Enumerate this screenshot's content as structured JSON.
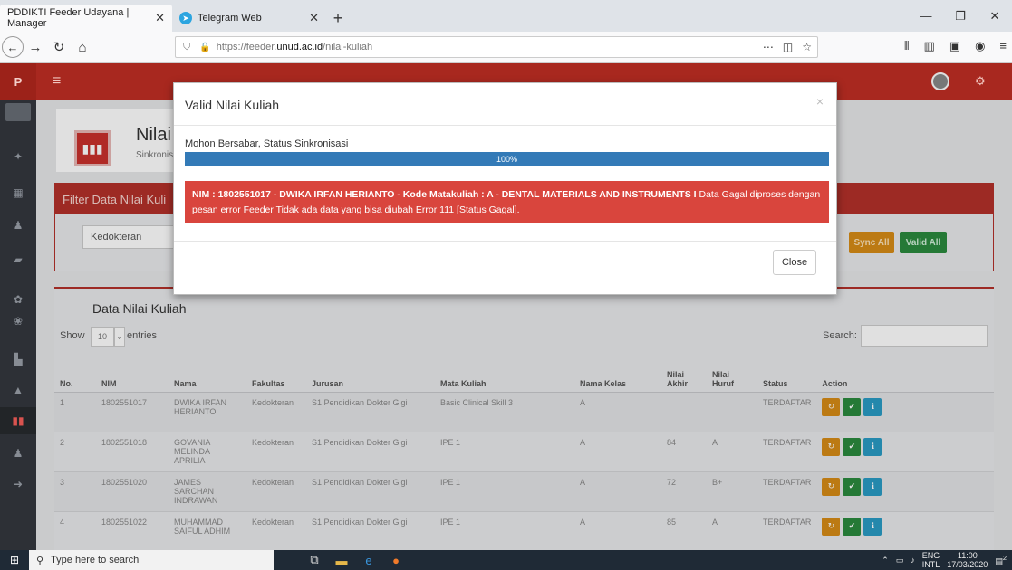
{
  "browser": {
    "tabs": [
      {
        "title": "PDDIKTI Feeder Udayana | Manager"
      },
      {
        "title": "Telegram Web"
      }
    ],
    "url_prefix": "https://feeder.",
    "url_domain": "unud.ac.id",
    "url_path": "/nilai-kuliah"
  },
  "app": {
    "logo": "P",
    "page_title": "Nilai K",
    "page_subtitle": "Sinkronisa",
    "filter_title": "Filter Data Nilai Kuli",
    "filter_select": "Kedokteran",
    "sync_all": "Sync All",
    "valid_all": "Valid All",
    "data_title": "Data Nilai Kuliah",
    "show_label": "Show",
    "entries_value": "10",
    "entries_label": "entries",
    "search_label": "Search:"
  },
  "table": {
    "headers": [
      "No.",
      "NIM",
      "Nama",
      "Fakultas",
      "Jurusan",
      "Mata Kuliah",
      "Nama Kelas",
      "Nilai Akhir",
      "Nilai Huruf",
      "Status",
      "Action"
    ],
    "rows": [
      {
        "no": "1",
        "nim": "1802551017",
        "nama": "DWIKA IRFAN HERIANTO",
        "fakultas": "Kedokteran",
        "jurusan": "S1 Pendidikan Dokter Gigi",
        "matkul": "Basic Clinical Skill 3",
        "kelas": "A",
        "akhir": "",
        "huruf": "",
        "status": "TERDAFTAR"
      },
      {
        "no": "2",
        "nim": "1802551018",
        "nama": "GOVANIA MELINDA APRILIA",
        "fakultas": "Kedokteran",
        "jurusan": "S1 Pendidikan Dokter Gigi",
        "matkul": "IPE 1",
        "kelas": "A",
        "akhir": "84",
        "huruf": "A",
        "status": "TERDAFTAR"
      },
      {
        "no": "3",
        "nim": "1802551020",
        "nama": "JAMES SARCHAN INDRAWAN",
        "fakultas": "Kedokteran",
        "jurusan": "S1 Pendidikan Dokter Gigi",
        "matkul": "IPE 1",
        "kelas": "A",
        "akhir": "72",
        "huruf": "B+",
        "status": "TERDAFTAR"
      },
      {
        "no": "4",
        "nim": "1802551022",
        "nama": "MUHAMMAD SAIFUL ADHIM",
        "fakultas": "Kedokteran",
        "jurusan": "S1 Pendidikan Dokter Gigi",
        "matkul": "IPE 1",
        "kelas": "A",
        "akhir": "85",
        "huruf": "A",
        "status": "TERDAFTAR"
      }
    ]
  },
  "modal": {
    "title": "Valid Nilai Kuliah",
    "close_x": "×",
    "wait_text": "Mohon Bersabar, Status Sinkronisasi",
    "progress_percent": 100,
    "progress_label": "100%",
    "alert_bold": "NIM : 1802551017 - DWIKA IRFAN HERIANTO - Kode Matakuliah : A - DENTAL MATERIALS AND INSTRUMENTS I",
    "alert_text": " Data Gagal diproses dengan pesan error Feeder Tidak ada data yang bisa diubah Error 111 [Status Gagal].",
    "close_button": "Close"
  },
  "taskbar": {
    "search_placeholder": "Type here to search",
    "lang1": "ENG",
    "lang2": "INTL",
    "time": "11:00",
    "date": "17/03/2020",
    "notif_count": "2"
  },
  "colors": {
    "app_red": "#a8281f",
    "progress_blue": "#337ab7",
    "alert_red": "#d9453d"
  },
  "icons": [
    "telegram-icon",
    "back-icon",
    "forward-icon",
    "reload-icon",
    "home-icon",
    "lock-icon",
    "bookmark-icon",
    "library-icon",
    "hamburger-icon",
    "windows-icon",
    "search-icon"
  ]
}
